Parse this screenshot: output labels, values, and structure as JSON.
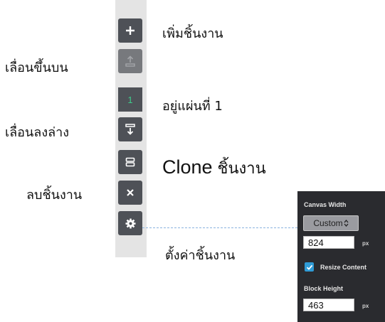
{
  "toolbar": {
    "add_icon": "plus-icon",
    "move_up_icon": "move-up-icon",
    "page_number": "1",
    "move_down_icon": "move-down-icon",
    "clone_icon": "clone-icon",
    "delete_icon": "close-icon",
    "settings_icon": "gear-icon",
    "accent_color": "#3ecb8b"
  },
  "annotations": {
    "add": "เพิ่มชิ้นงาน",
    "move_up": "เลื่อนขึ้นบน",
    "page": "อยู่แผ่นที่ 1",
    "move_down": "เลื่อนลงล่าง",
    "clone_word": "Clone",
    "clone_suffix": " ชิ้นงาน",
    "delete": "ลบชิ้นงาน",
    "settings": "ตั้งค่าชิ้นงาน"
  },
  "settings_panel": {
    "canvas_width_label": "Canvas Width",
    "select_value": "Custom",
    "canvas_width_value": "824",
    "canvas_width_unit": "px",
    "resize_content_label": "Resize Content",
    "resize_content_checked": true,
    "block_height_label": "Block Height",
    "block_height_value": "463",
    "block_height_unit": "px"
  }
}
